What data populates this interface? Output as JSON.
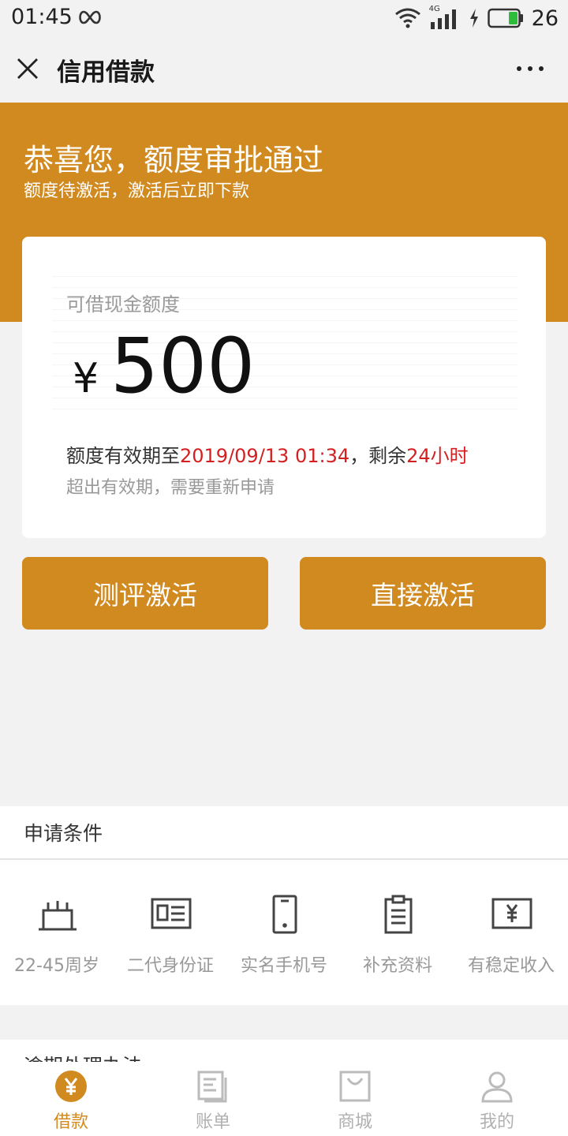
{
  "status_bar": {
    "time": "01:45",
    "network": "4G",
    "battery_level": "26"
  },
  "titlebar": {
    "title": "信用借款"
  },
  "hero": {
    "title": "恭喜您，额度审批通过",
    "subtitle": "额度待激活，激活后立即下款"
  },
  "card": {
    "label": "可借现金额度",
    "currency": "¥",
    "amount": "500",
    "validity_prefix": "额度有效期至",
    "validity_date": "2019/09/13 01:34",
    "validity_middle": "，剩余",
    "validity_remaining": "24小时",
    "note": "超出有效期，需要重新申请"
  },
  "buttons": {
    "evaluate": "测评激活",
    "direct": "直接激活"
  },
  "conditions": {
    "title": "申请条件",
    "items": [
      {
        "label": "22-45周岁",
        "icon": "cake-icon"
      },
      {
        "label": "二代身份证",
        "icon": "id-card-icon"
      },
      {
        "label": "实名手机号",
        "icon": "phone-icon"
      },
      {
        "label": "补充资料",
        "icon": "clipboard-icon"
      },
      {
        "label": "有稳定收入",
        "icon": "money-icon"
      }
    ]
  },
  "overdue": {
    "title": "逾期处理办法"
  },
  "nav": {
    "items": [
      {
        "label": "借款",
        "icon": "loan-icon",
        "active": true
      },
      {
        "label": "账单",
        "icon": "bill-icon",
        "active": false
      },
      {
        "label": "商城",
        "icon": "shop-icon",
        "active": false
      },
      {
        "label": "我的",
        "icon": "profile-icon",
        "active": false
      }
    ]
  },
  "colors": {
    "accent": "#d18a20",
    "highlight": "#d42020",
    "background": "#f2f2f2"
  }
}
